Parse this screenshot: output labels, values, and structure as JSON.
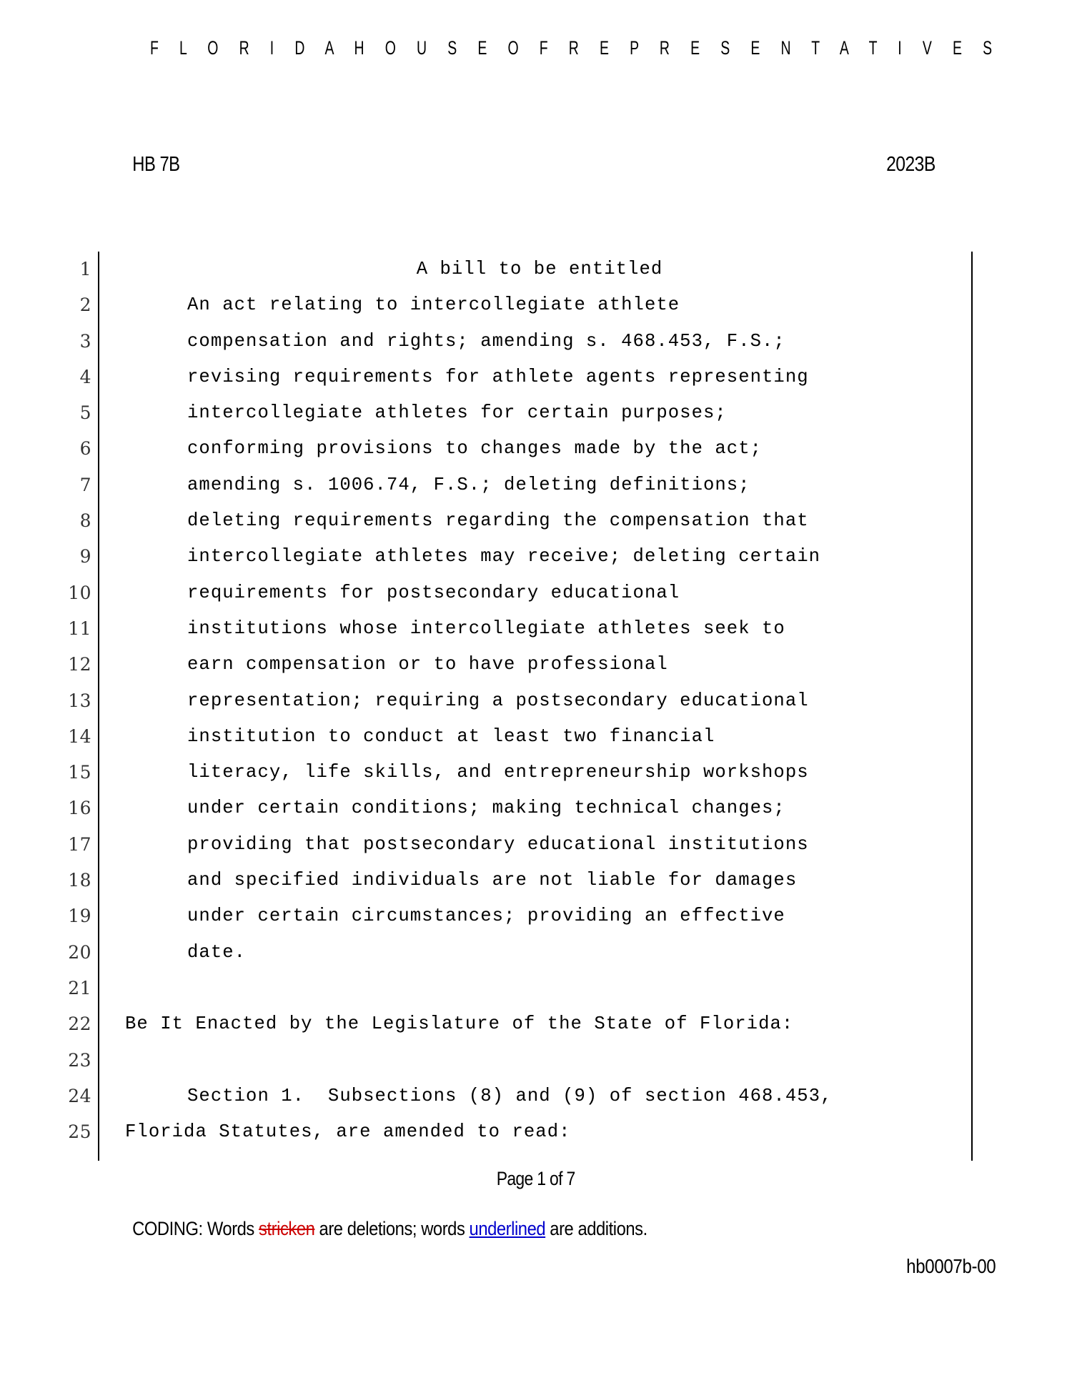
{
  "masthead": {
    "title": "F L O R I D A    H O U S E    O F    R E P R E S E N T A T I V E S"
  },
  "bill_header": {
    "bill_number": "HB 7B",
    "session_year": "2023B"
  },
  "body": {
    "lines": [
      {
        "num": "1",
        "text": "A bill to be entitled",
        "style": "center"
      },
      {
        "num": "2",
        "text": "An act relating to intercollegiate athlete",
        "style": "indent"
      },
      {
        "num": "3",
        "text": "compensation and rights; amending s. 468.453, F.S.;",
        "style": "indent"
      },
      {
        "num": "4",
        "text": "revising requirements for athlete agents representing",
        "style": "indent"
      },
      {
        "num": "5",
        "text": "intercollegiate athletes for certain purposes;",
        "style": "indent"
      },
      {
        "num": "6",
        "text": "conforming provisions to changes made by the act;",
        "style": "indent"
      },
      {
        "num": "7",
        "text": "amending s. 1006.74, F.S.; deleting definitions;",
        "style": "indent"
      },
      {
        "num": "8",
        "text": "deleting requirements regarding the compensation that",
        "style": "indent"
      },
      {
        "num": "9",
        "text": "intercollegiate athletes may receive; deleting certain",
        "style": "indent"
      },
      {
        "num": "10",
        "text": "requirements for postsecondary educational",
        "style": "indent"
      },
      {
        "num": "11",
        "text": "institutions whose intercollegiate athletes seek to",
        "style": "indent"
      },
      {
        "num": "12",
        "text": "earn compensation or to have professional",
        "style": "indent"
      },
      {
        "num": "13",
        "text": "representation; requiring a postsecondary educational",
        "style": "indent"
      },
      {
        "num": "14",
        "text": "institution to conduct at least two financial",
        "style": "indent"
      },
      {
        "num": "15",
        "text": "literacy, life skills, and entrepreneurship workshops",
        "style": "indent"
      },
      {
        "num": "16",
        "text": "under certain conditions; making technical changes;",
        "style": "indent"
      },
      {
        "num": "17",
        "text": "providing that postsecondary educational institutions",
        "style": "indent"
      },
      {
        "num": "18",
        "text": "and specified individuals are not liable for damages",
        "style": "indent"
      },
      {
        "num": "19",
        "text": "under certain circumstances; providing an effective",
        "style": "indent"
      },
      {
        "num": "20",
        "text": "date.",
        "style": "indent"
      },
      {
        "num": "21",
        "text": "",
        "style": "plain"
      },
      {
        "num": "22",
        "text": "Be It Enacted by the Legislature of the State of Florida:",
        "style": "plain"
      },
      {
        "num": "23",
        "text": "",
        "style": "plain"
      },
      {
        "num": "24",
        "text": "Section 1.  Subsections (8) and (9) of section 468.453,",
        "style": "indent"
      },
      {
        "num": "25",
        "text": "Florida Statutes, are amended to read:",
        "style": "plain"
      }
    ]
  },
  "footer": {
    "page_label": "Page 1 of 7",
    "coding": {
      "prefix": "CODING:  Words ",
      "stricken_word": "stricken",
      "middle": " are deletions; words ",
      "underlined_word": "underlined",
      "suffix": " are additions."
    },
    "document_id": "hb0007b-00"
  },
  "colors": {
    "deletion": "#cc0000",
    "addition": "#0000cc",
    "text": "#000000",
    "background": "#ffffff"
  }
}
